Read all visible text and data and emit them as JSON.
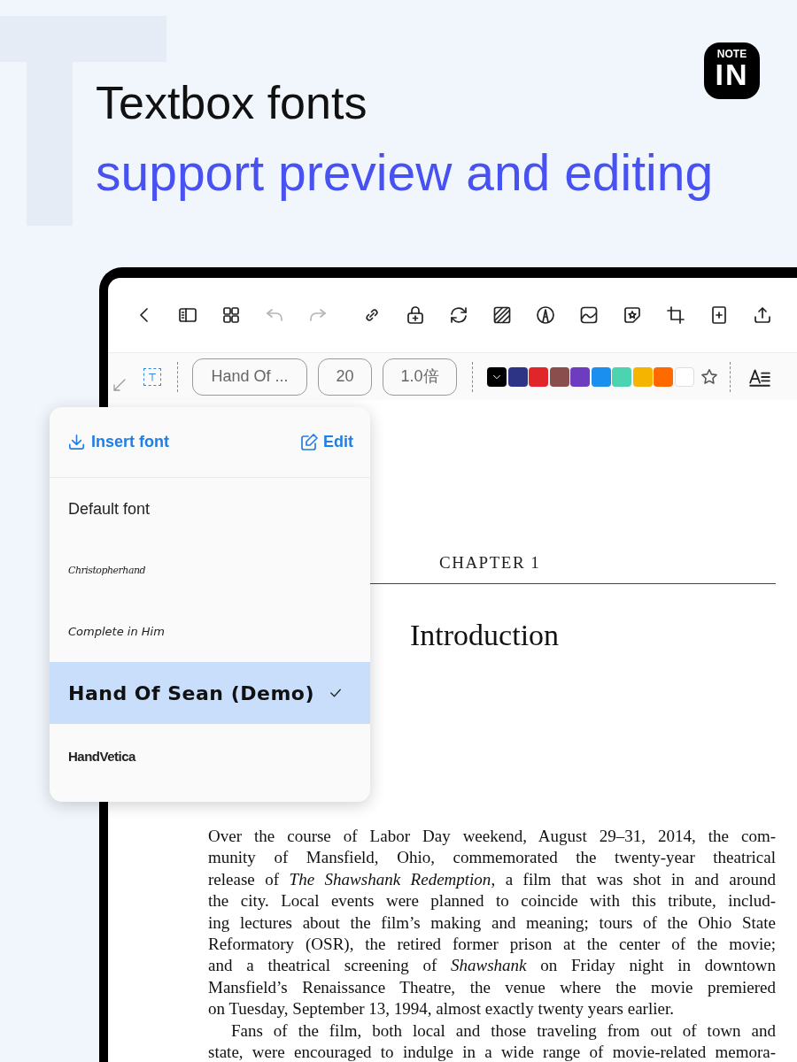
{
  "logo": {
    "top": "NOTE",
    "main": "IN"
  },
  "headline": {
    "title": "Textbox fonts",
    "subtitle": "support preview and editing"
  },
  "toolbar": [
    {
      "kind": "back",
      "disabled": false
    },
    {
      "kind": "sidebar",
      "disabled": false
    },
    {
      "kind": "grid",
      "disabled": false
    },
    {
      "kind": "undo",
      "disabled": true
    },
    {
      "kind": "redo",
      "disabled": true
    },
    {
      "kind": "link",
      "disabled": false
    },
    {
      "kind": "lock",
      "disabled": false
    },
    {
      "kind": "sync",
      "disabled": false
    },
    {
      "kind": "hatch",
      "disabled": false
    },
    {
      "kind": "pen",
      "disabled": false
    },
    {
      "kind": "image",
      "disabled": false
    },
    {
      "kind": "sticker",
      "disabled": false
    },
    {
      "kind": "crop",
      "disabled": false
    },
    {
      "kind": "addpage",
      "disabled": false
    },
    {
      "kind": "share",
      "disabled": false
    }
  ],
  "text_options": {
    "font": "Hand Of ...",
    "size": "20",
    "spacing": "1.0倍",
    "swatches": [
      {
        "color": "#000000",
        "selected": true
      },
      {
        "color": "#2e3485",
        "selected": false
      },
      {
        "color": "#e0262b",
        "selected": false
      },
      {
        "color": "#8a4f4d",
        "selected": false
      },
      {
        "color": "#6e3cbf",
        "selected": false
      },
      {
        "color": "#1a8ff0",
        "selected": false
      },
      {
        "color": "#4cd4b0",
        "selected": false
      },
      {
        "color": "#f5b400",
        "selected": false
      },
      {
        "color": "#ff6a00",
        "selected": false
      },
      {
        "color": "#ffffff",
        "selected": false
      }
    ]
  },
  "font_menu": {
    "insert": "Insert font",
    "edit": "Edit",
    "fonts": [
      {
        "name": "Default font",
        "kind": "sans",
        "selected": false
      },
      {
        "name": "Christopherhand",
        "kind": "script",
        "selected": false
      },
      {
        "name": "Complete in Him",
        "kind": "hand",
        "selected": false
      },
      {
        "name": "Hand Of Sean (Demo)",
        "kind": "marker",
        "selected": true
      },
      {
        "name": "HandVetica",
        "kind": "condensed",
        "selected": false
      }
    ]
  },
  "document": {
    "chapter": "CHAPTER 1",
    "title": "Introduction",
    "paragraphs": [
      {
        "indent": false,
        "lines": [
          "Over the course of Labor Day weekend, August 29–31, 2014, the com-",
          "munity of Mansfield, Ohio, commemorated the twenty-year theatrical",
          "release of *The Shawshank Redemption*, a film that was shot in and around",
          "the city. Local events were planned to coincide with this tribute, includ-",
          "ing lectures about the film’s making and meaning; tours of the Ohio State",
          "Reformatory (OSR), the retired former prison at the center of the movie;",
          "and a theatrical screening of *Shawshank* on Friday night in downtown",
          "Mansfield’s Renaissance Theatre, the venue where the movie premiered",
          "on Tuesday, September 13, 1994, almost exactly twenty years earlier."
        ]
      },
      {
        "indent": true,
        "lines": [
          "Fans of the film, both local and those traveling from out of town and",
          "state, were encouraged to indulge in a wide range of movie-related memora-"
        ]
      }
    ]
  }
}
